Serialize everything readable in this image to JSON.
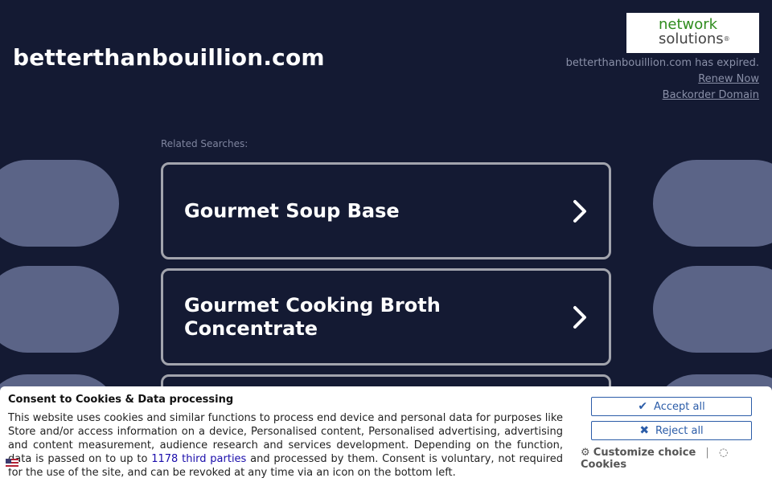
{
  "header": {
    "domain": "betterthanbouillion.com",
    "logo": {
      "line1": "network",
      "line2": "solutions",
      "mark": "®"
    },
    "expired_text": "betterthanbouillion.com has expired.",
    "renew_label": "Renew Now",
    "backorder_label": "Backorder Domain"
  },
  "related": {
    "label": "Related Searches:",
    "items": [
      {
        "label": "Gourmet Soup Base"
      },
      {
        "label": "Gourmet Cooking Broth Concentrate"
      },
      {
        "label": ""
      }
    ]
  },
  "consent": {
    "title": "Consent to Cookies & Data processing",
    "body_before": "This website uses cookies and similar functions to process end device and personal data for purposes like Store and/or access information on a device, Personalised content, Personalised advertising, advertising and content measurement, audience research and services development. Depending on the function, data is passed on to up to ",
    "third_parties_link": "1178 third parties",
    "body_after": " and processed by them. Consent is voluntary, not required for the use of the site, and can be revoked at any time via an icon on the bottom left.",
    "accept_label": "Accept all",
    "reject_label": "Reject all",
    "customize_label": "Customize choice",
    "separator": "|",
    "cookies_label": "Cookies"
  },
  "colors": {
    "background": "#141a33",
    "bg_pill": "#5b6487",
    "card_border": "#a2a4ad",
    "button_blue": "#2b5ca8",
    "logo_green": "#2f8c1e"
  },
  "icons": {
    "card_arrow": "chevron-right-icon",
    "accept": "check-icon",
    "reject": "close-icon",
    "customize": "gear-icon",
    "cookies": "cookie-icon",
    "language": "flag-icon"
  }
}
